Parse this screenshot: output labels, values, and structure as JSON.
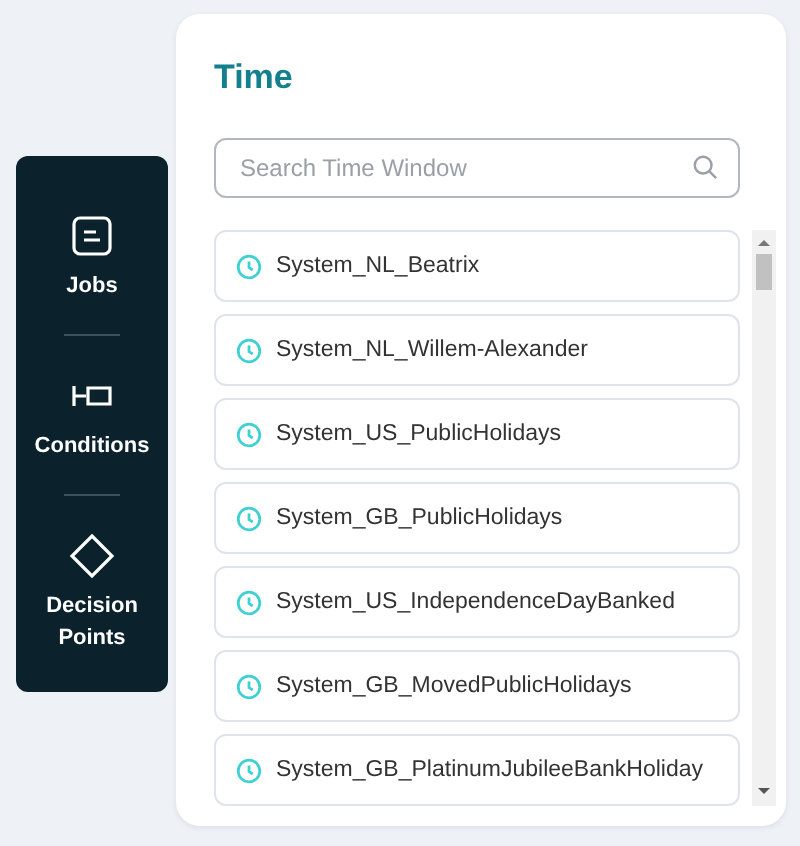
{
  "sidebar": {
    "items": [
      {
        "kind": "jobs",
        "label": "Jobs"
      },
      {
        "kind": "conditions",
        "label": "Conditions"
      },
      {
        "kind": "decision",
        "label": "Decision Points"
      }
    ]
  },
  "panel": {
    "title": "Time",
    "search": {
      "placeholder": "Search Time Window"
    },
    "items": [
      "System_NL_Beatrix",
      "System_NL_Willem-Alexander",
      "System_US_PublicHolidays",
      "System_GB_PublicHolidays",
      "System_US_IndependenceDayBanked",
      "System_GB_MovedPublicHolidays",
      "System_GB_PlatinumJubileeBankHoliday"
    ]
  }
}
